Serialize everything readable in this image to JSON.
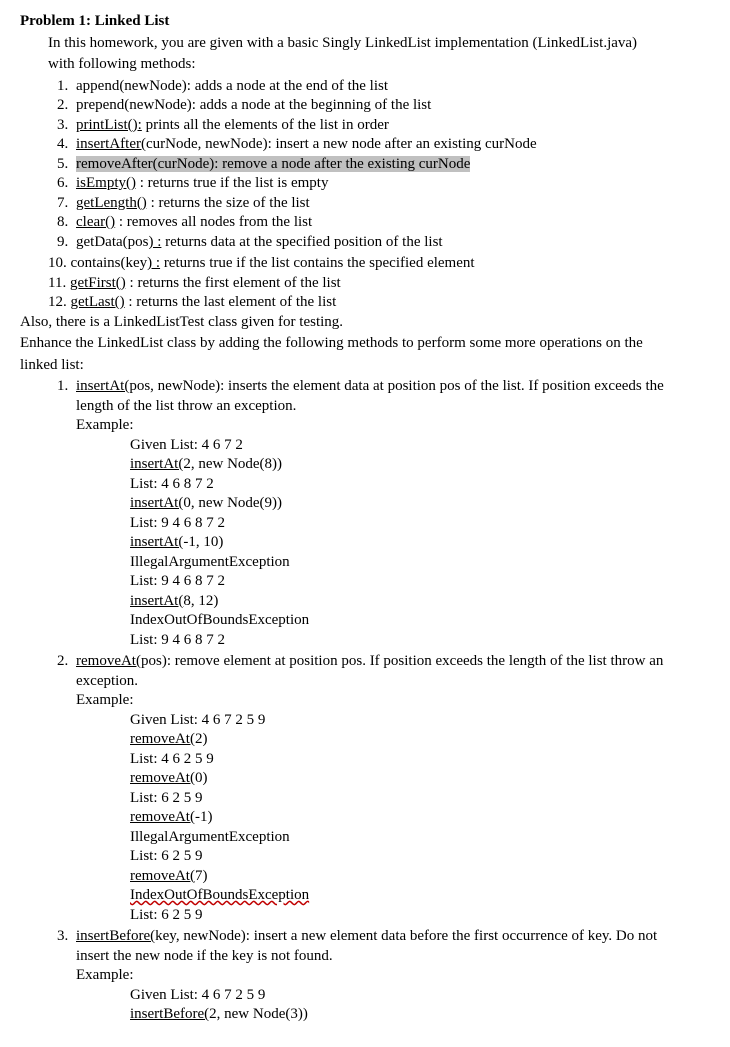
{
  "title": "Problem 1: Linked List",
  "intro1": "In this homework, you are given with a basic Singly LinkedList implementation (LinkedList.java)",
  "intro2": "with following methods:",
  "methods": {
    "m1a": "append(newNode):",
    "m1b": " adds a node at the end of the list",
    "m2a": "prepend(newNode):",
    "m2b": " adds a node at the beginning of the list",
    "m3a": "printList():",
    "m3b": " prints all the elements of the list in order",
    "m4a": "insertAfter(",
    "m4b": "curNode, newNode): insert a new node after an existing curNode",
    "m5": "removeAfter(curNode): remove a node after the existing curNode",
    "m6a": "isEmpty()",
    "m6b": " : returns true if the list is empty",
    "m7a": "getLength()",
    "m7b": " : returns the size of the list",
    "m8a": "clear()",
    "m8b": " : removes all nodes from the list",
    "m9a": "getData(pos",
    "m9b": ") :",
    "m9c": " returns data at the specified position of the list",
    "m10n": "10. ",
    "m10a": "contains(key",
    "m10b": ") :",
    "m10c": " returns true if the list contains the specified element",
    "m11n": "11. ",
    "m11a": "getFirst()",
    "m11b": " : returns the first element of the list",
    "m12n": "12. ",
    "m12a": "getLast()",
    "m12b": " : returns the last element of the list"
  },
  "also": "Also, there is a LinkedListTest class given for testing.",
  "enhance1": "Enhance the LinkedList class by adding the following methods to perform some more operations on the",
  "enhance2": "linked list:",
  "e1a": "insertAt(",
  "e1b": "pos, newNode): inserts the element data at position pos of the list. If position exceeds the",
  "e1c": "length of the list throw an exception.",
  "example_label": "Example:",
  "ex1": {
    "l1": "Given List:  4 6 7 2",
    "l2": "insertAt(",
    "l2b": "2, new Node(8))",
    "l3": "List: 4 6 8 7 2",
    "l4": "insertAt(",
    "l4b": "0, new Node(9))",
    "l5": "List: 9 4 6 8 7 2",
    "l6": "insertAt(",
    "l6b": "-1, 10)",
    "l7": "IllegalArgumentException",
    "l8": "List: 9 4 6 8 7 2",
    "l9": "insertAt(",
    "l9b": "8, 12)",
    "l10": "IndexOutOfBoundsException",
    "l11": "List: 9 4 6 8 7 2"
  },
  "e2a": "removeAt(",
  "e2b": "pos): remove element at position pos. If position exceeds the length of the list throw an",
  "e2c": "exception.",
  "ex2": {
    "l1": "Given List:  4 6 7 2 5 9",
    "l2": "removeAt(",
    "l2b": "2)",
    "l3": "List:  4 6 2 5 9",
    "l4": "removeAt(",
    "l4b": "0)",
    "l5": "List:  6 2 5 9",
    "l6": "removeAt(",
    "l6b": "-1)",
    "l7": "IllegalArgumentException",
    "l8": "List:  6 2 5 9",
    "l9": "removeAt(",
    "l9b": "7)",
    "l10": "IndexOutOfBoundsException",
    "l11": "List: 6 2 5 9"
  },
  "e3a": "insertBefore(",
  "e3b": "key, newNode): insert a new element data before the first occurrence of key. Do not",
  "e3c": "insert the new node if the key is not found.",
  "ex3": {
    "l1": "Given List:  4 6 7 2 5 9",
    "l2": "insertBefore(",
    "l2b": "2, new Node(3))"
  }
}
